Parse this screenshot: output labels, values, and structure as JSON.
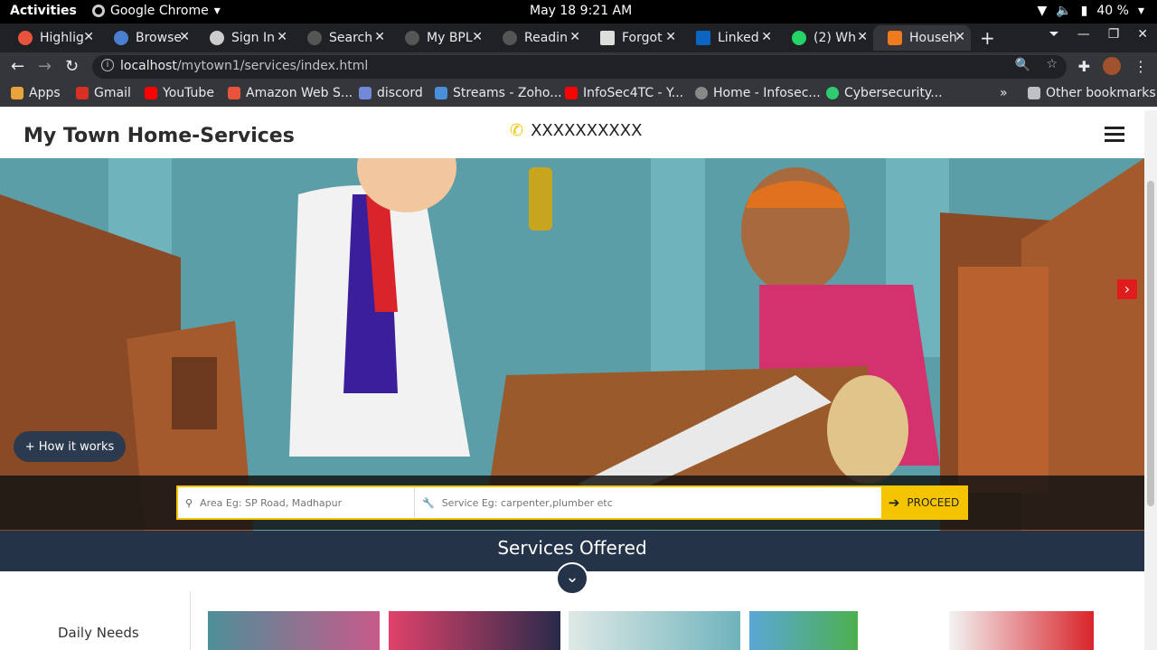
{
  "os": {
    "activities": "Activities",
    "app_name": "Google Chrome",
    "clock": "May 18  9:21 AM",
    "battery": "40 %"
  },
  "tabs": [
    {
      "label": "Highlig",
      "favicon_color": "#e8543b"
    },
    {
      "label": "Browse",
      "favicon_color": "#4a7fd0"
    },
    {
      "label": "Sign In",
      "favicon_color": "#cccccc"
    },
    {
      "label": "Search",
      "favicon_color": "#555555"
    },
    {
      "label": "My BPL",
      "favicon_color": "#555555"
    },
    {
      "label": "Readin",
      "favicon_color": "#555555"
    },
    {
      "label": "Forgot",
      "favicon_color": "#dddddd"
    },
    {
      "label": "Linked",
      "favicon_color": "#0a66c2"
    },
    {
      "label": "(2) Wh",
      "favicon_color": "#25d366"
    },
    {
      "label": "Househ",
      "favicon_color": "#f07b1e"
    }
  ],
  "omnibox": {
    "host": "localhost",
    "path": "/mytown1/services/index.html"
  },
  "bookmarks": [
    {
      "label": "Apps",
      "color": "#e8a33c"
    },
    {
      "label": "Gmail",
      "color": "#d93025"
    },
    {
      "label": "YouTube",
      "color": "#ff0000"
    },
    {
      "label": "Amazon Web S...",
      "color": "#e8543b"
    },
    {
      "label": "discord",
      "color": "#7289da"
    },
    {
      "label": "Streams - Zoho...",
      "color": "#4a90d9"
    },
    {
      "label": "InfoSec4TC - Y...",
      "color": "#ff0000"
    },
    {
      "label": "Home - Infosec...",
      "color": "#888888"
    },
    {
      "label": "Cybersecurity...",
      "color": "#2ecc71"
    }
  ],
  "other_bookmarks": "Other bookmarks",
  "site": {
    "title": "My Town Home-Services",
    "phone": "XXXXXXXXXX",
    "how_it_works": "+ How it works",
    "area_placeholder": "Area Eg: SP Road, Madhapur",
    "service_placeholder": "Service Eg: carpenter,plumber etc",
    "proceed": "PROCEED",
    "services_offered": "Services Offered",
    "daily_needs": "Daily Needs"
  },
  "colors": {
    "search_accent": "#f5c400",
    "banner_dark": "#253348"
  }
}
